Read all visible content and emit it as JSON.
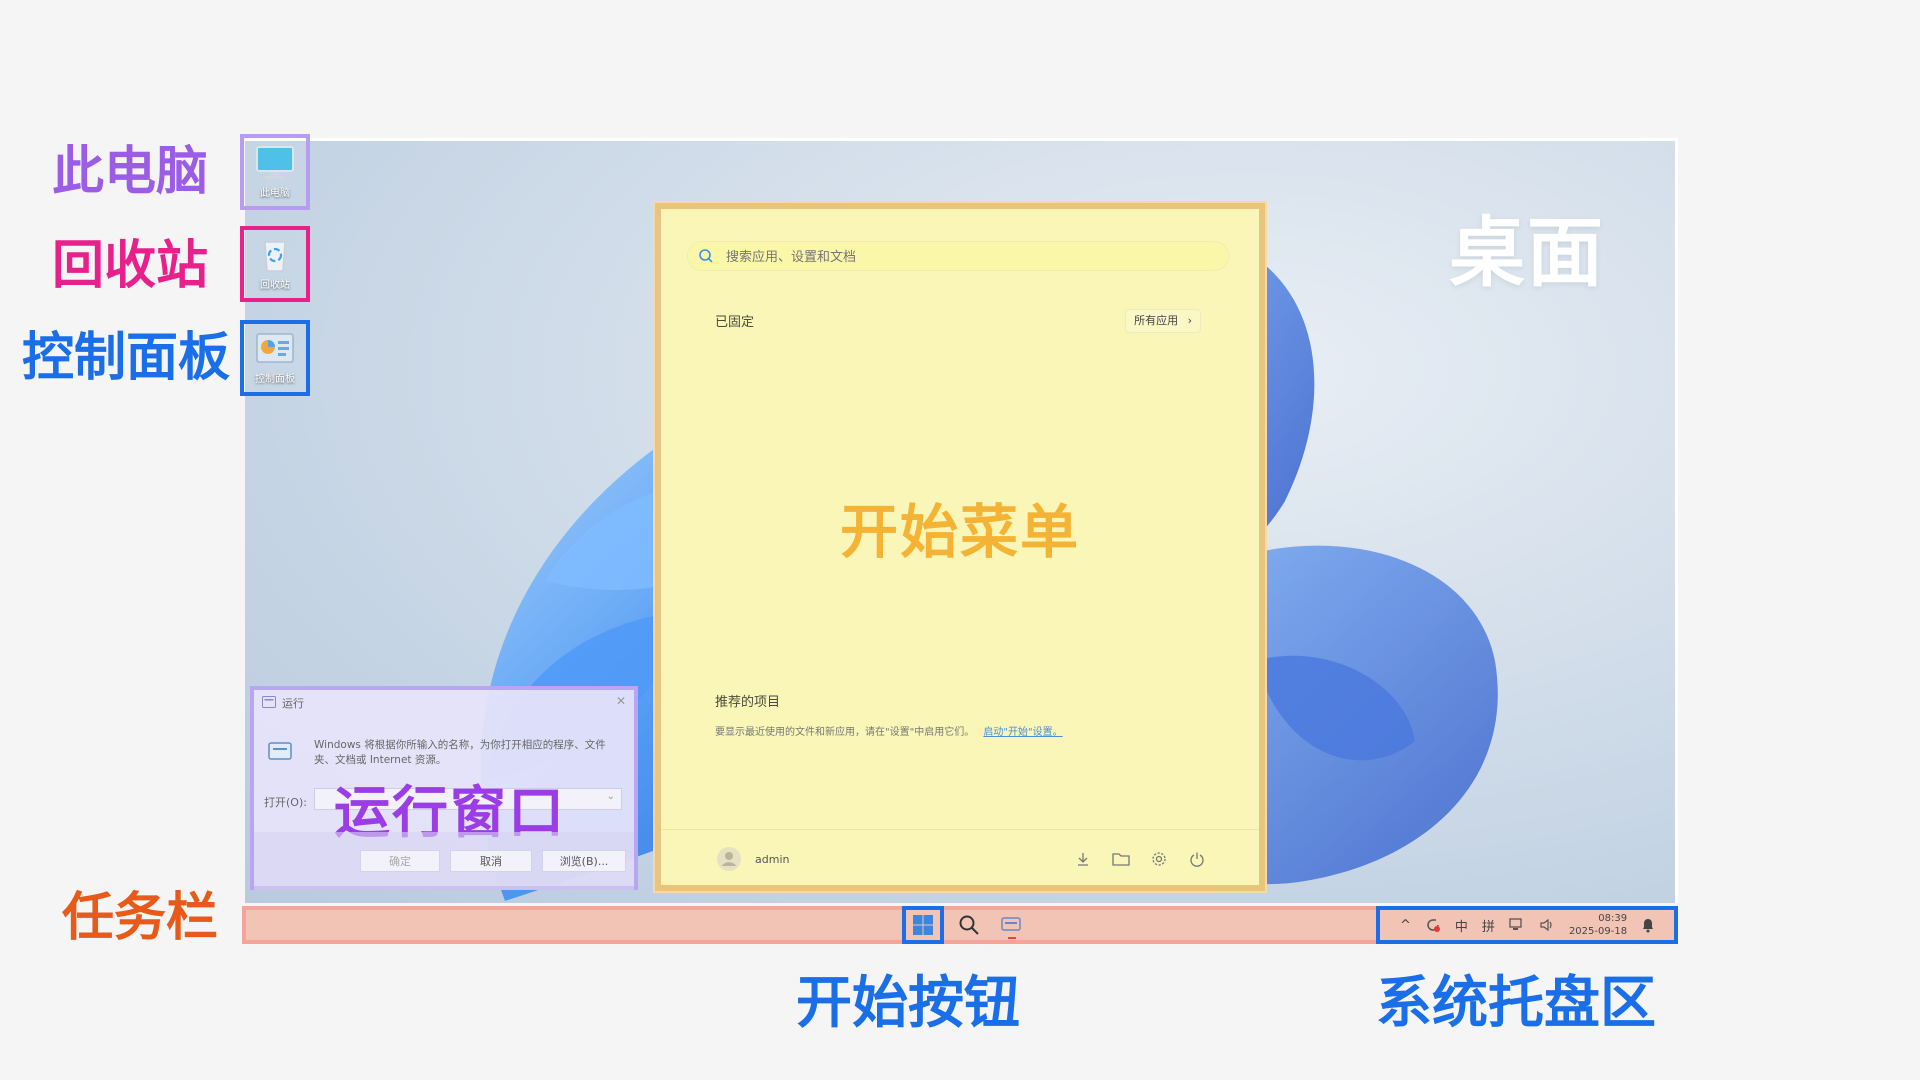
{
  "annotations": {
    "this_pc": "此电脑",
    "recycle_bin": "回收站",
    "control_panel": "控制面板",
    "taskbar": "任务栏",
    "desktop": "桌面",
    "start_menu": "开始菜单",
    "run_window": "运行窗口",
    "start_button": "开始按钮",
    "system_tray": "系统托盘区"
  },
  "desktop_icons": [
    {
      "label": "此电脑",
      "icon": "monitor-icon"
    },
    {
      "label": "回收站",
      "icon": "recycle-bin-icon"
    },
    {
      "label": "控制面板",
      "icon": "control-panel-icon"
    }
  ],
  "start_menu": {
    "search_placeholder": "搜索应用、设置和文档",
    "pinned_title": "已固定",
    "all_apps_label": "所有应用",
    "recommended_title": "推荐的项目",
    "recommended_desc": "要显示最近使用的文件和新应用，请在\"设置\"中启用它们。",
    "recommended_link": "启动\"开始\"设置。",
    "user_name": "admin",
    "footer_icons": [
      "download-icon",
      "folder-icon",
      "settings-icon",
      "power-icon"
    ]
  },
  "run_window": {
    "title": "运行",
    "description": "Windows 将根据你所输入的名称，为你打开相应的程序、文件夹、文档或 Internet 资源。",
    "open_label": "打开(O):",
    "open_value": "",
    "ok_label": "确定",
    "cancel_label": "取消",
    "browse_label": "浏览(B)..."
  },
  "taskbar": {
    "tray": {
      "ime_mode": "中",
      "ime_name": "拼",
      "time": "08:39",
      "date": "2025-09-18"
    }
  },
  "colors": {
    "purple": "#9b5de5",
    "pink": "#e8208c",
    "blue": "#1a6fe8",
    "orange": "#e85a1a",
    "start_menu_label": "#f5b335",
    "run_label": "#9b3de6"
  }
}
